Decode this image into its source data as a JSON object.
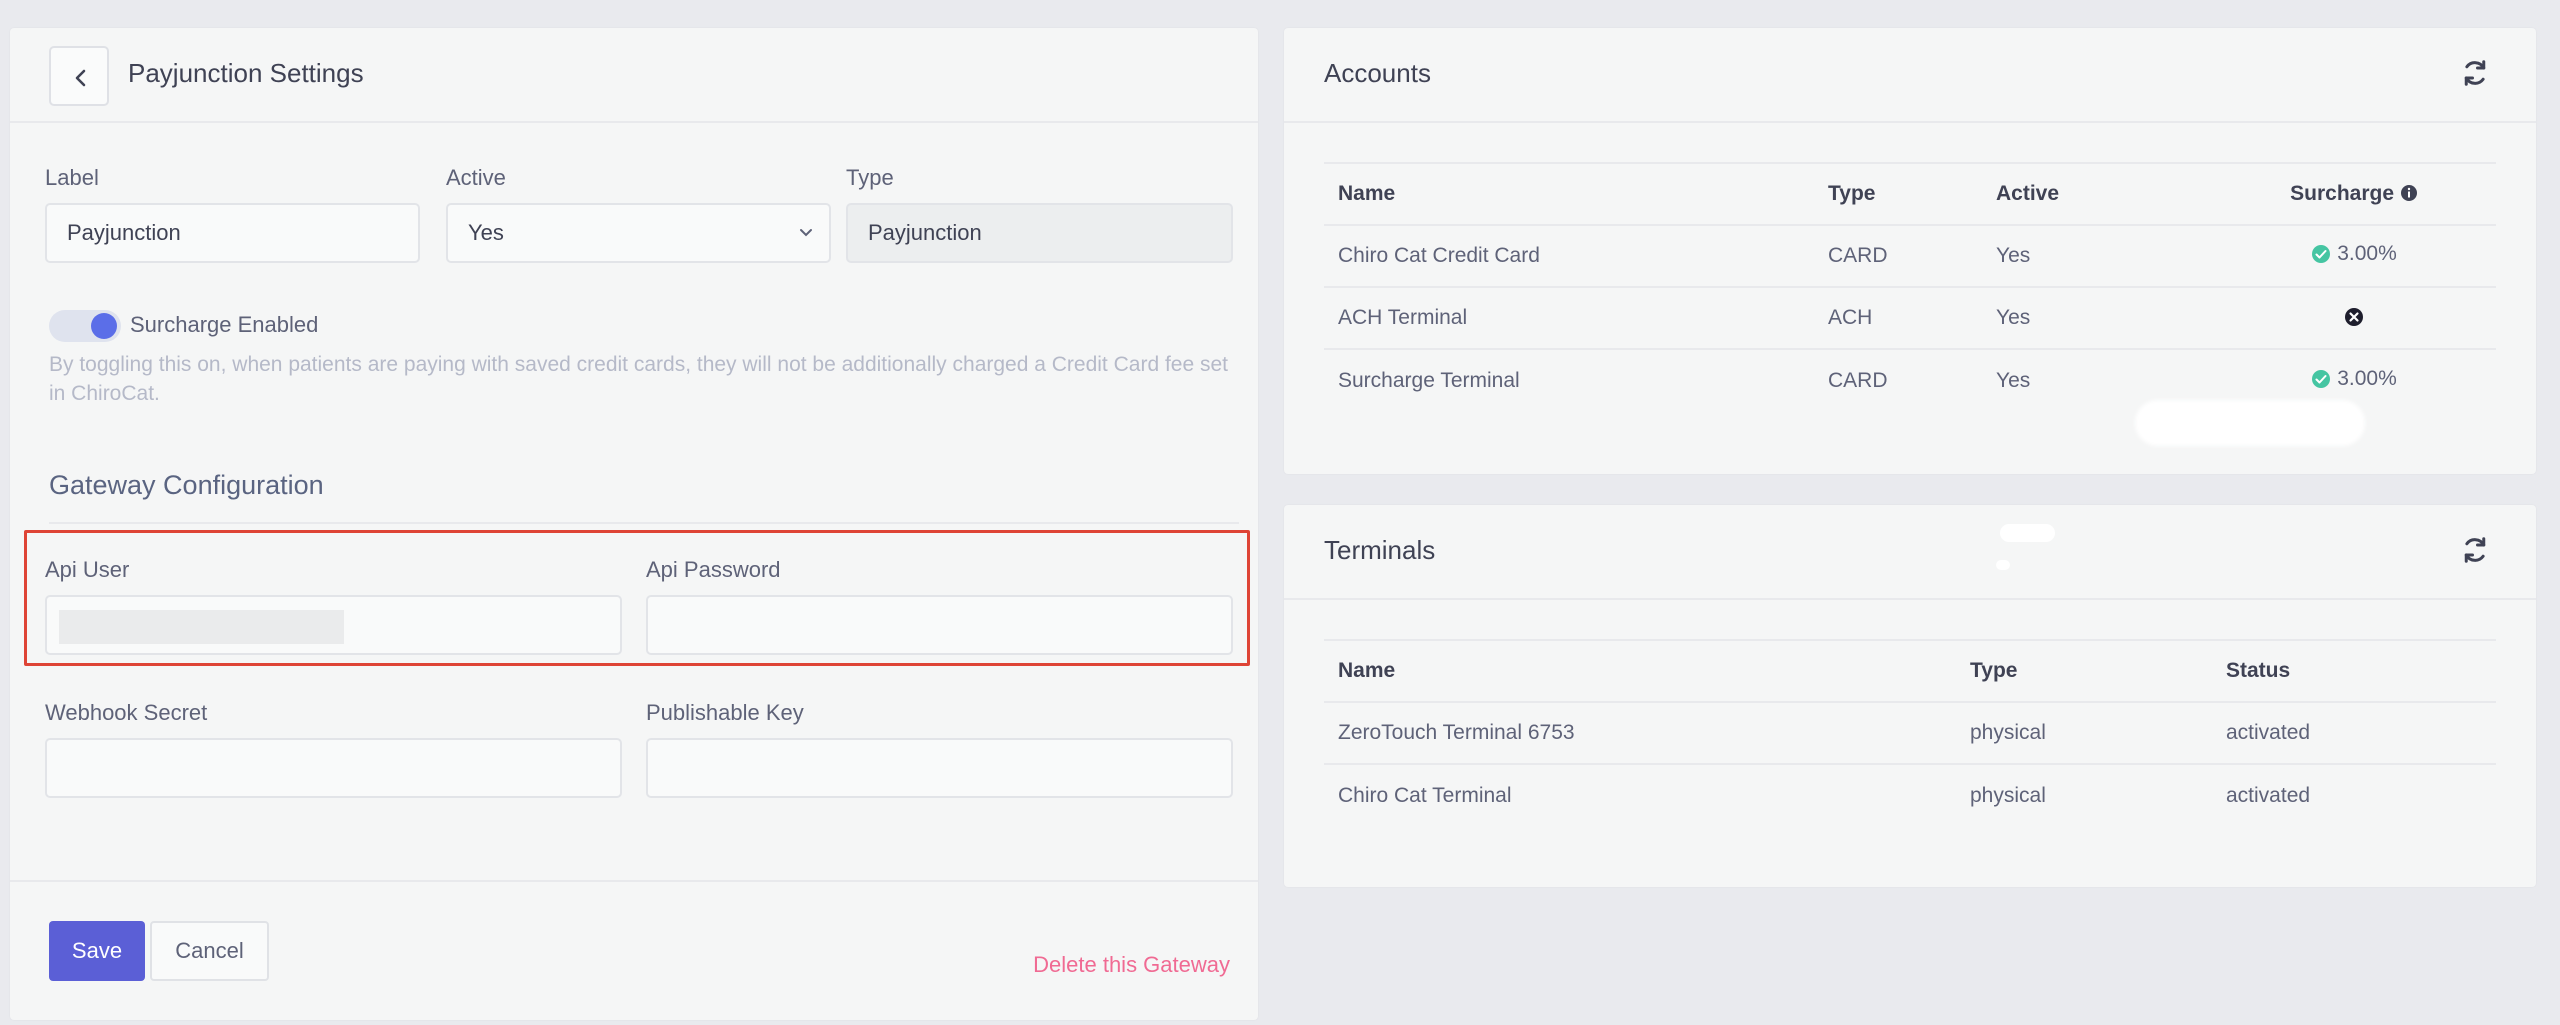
{
  "left": {
    "title": "Payjunction Settings",
    "label_label": "Label",
    "label_value": "Payjunction",
    "active_label": "Active",
    "active_value": "Yes",
    "type_label": "Type",
    "type_value": "Payjunction",
    "surcharge_toggle_label": "Surcharge Enabled",
    "surcharge_enabled": true,
    "help_text": "By toggling this on, when patients are paying with saved credit cards, they will not be additionally charged a Credit Card fee set in ChiroCat.",
    "gateway_title": "Gateway Configuration",
    "api_user_label": "Api User",
    "api_user_value": "",
    "api_password_label": "Api Password",
    "api_password_value": "",
    "webhook_label": "Webhook Secret",
    "webhook_value": "",
    "publishable_label": "Publishable Key",
    "publishable_value": "",
    "save_label": "Save",
    "cancel_label": "Cancel",
    "delete_label": "Delete this Gateway"
  },
  "accounts": {
    "title": "Accounts",
    "columns": [
      "Name",
      "Type",
      "Active",
      "Surcharge"
    ],
    "rows": [
      {
        "name": "Chiro Cat Credit Card",
        "type": "CARD",
        "active": "Yes",
        "surcharge": "3.00%",
        "surcharge_on": true
      },
      {
        "name": "ACH Terminal",
        "type": "ACH",
        "active": "Yes",
        "surcharge": "",
        "surcharge_on": false
      },
      {
        "name": "Surcharge Terminal",
        "type": "CARD",
        "active": "Yes",
        "surcharge": "3.00%",
        "surcharge_on": true
      }
    ]
  },
  "terminals": {
    "title": "Terminals",
    "columns": [
      "Name",
      "Type",
      "Status"
    ],
    "rows": [
      {
        "name": "ZeroTouch Terminal 6753",
        "type": "physical",
        "status": "activated"
      },
      {
        "name": "Chiro Cat Terminal",
        "type": "physical",
        "status": "activated"
      }
    ]
  },
  "colors": {
    "primary": "#5b5fd6",
    "danger_link": "#f06a93",
    "highlight_border": "#de4436",
    "success": "#45c5a2"
  }
}
